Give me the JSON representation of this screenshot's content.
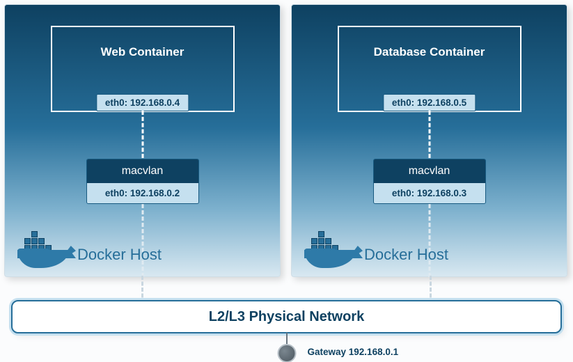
{
  "hosts": [
    {
      "container_title": "Web Container",
      "container_eth": "eth0: 192.168.0.4",
      "driver_name": "macvlan",
      "driver_eth": "eth0: 192.168.0.2",
      "host_label": "Docker  Host"
    },
    {
      "container_title": "Database Container",
      "container_eth": "eth0: 192.168.0.5",
      "driver_name": "macvlan",
      "driver_eth": "eth0: 192.168.0.3",
      "host_label": "Docker  Host"
    }
  ],
  "network_label": "L2/L3 Physical Network",
  "gateway_label": "Gateway 192.168.0.1",
  "chart_data": {
    "type": "network-diagram",
    "nodes": [
      {
        "id": "web_container",
        "label": "Web Container",
        "interface": "eth0",
        "ip": "192.168.0.4",
        "parent": "host1"
      },
      {
        "id": "db_container",
        "label": "Database Container",
        "interface": "eth0",
        "ip": "192.168.0.5",
        "parent": "host2"
      },
      {
        "id": "host1_macvlan",
        "label": "macvlan",
        "interface": "eth0",
        "ip": "192.168.0.2",
        "parent": "host1"
      },
      {
        "id": "host2_macvlan",
        "label": "macvlan",
        "interface": "eth0",
        "ip": "192.168.0.3",
        "parent": "host2"
      },
      {
        "id": "host1",
        "label": "Docker Host"
      },
      {
        "id": "host2",
        "label": "Docker Host"
      },
      {
        "id": "l2l3",
        "label": "L2/L3 Physical Network"
      },
      {
        "id": "gateway",
        "label": "Gateway",
        "ip": "192.168.0.1"
      }
    ],
    "edges": [
      [
        "web_container",
        "host1_macvlan"
      ],
      [
        "db_container",
        "host2_macvlan"
      ],
      [
        "host1_macvlan",
        "l2l3"
      ],
      [
        "host2_macvlan",
        "l2l3"
      ],
      [
        "l2l3",
        "gateway"
      ]
    ]
  }
}
